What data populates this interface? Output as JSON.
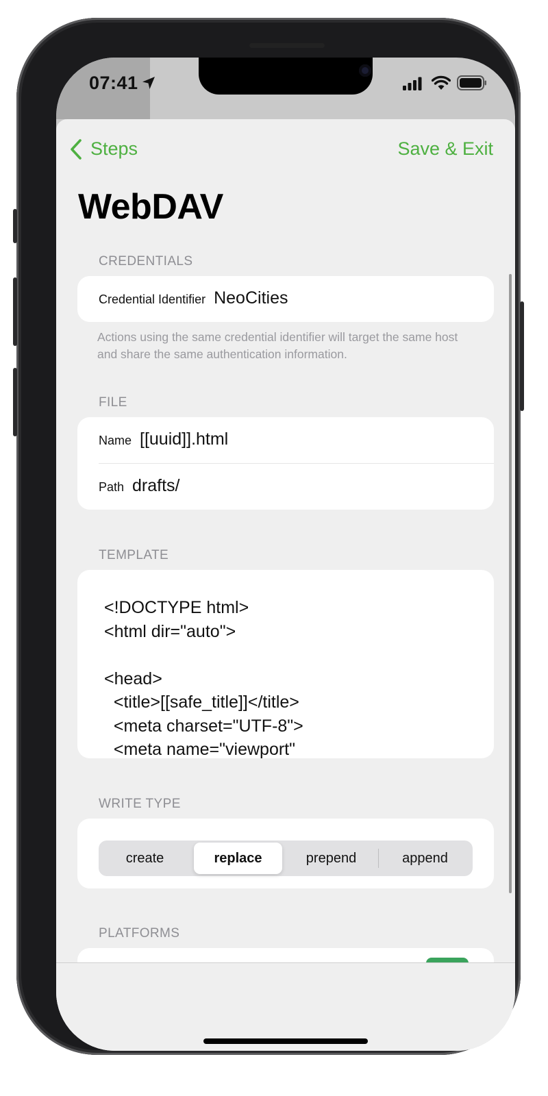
{
  "status_bar": {
    "time": "07:41"
  },
  "nav": {
    "back_label": "Steps",
    "save_label": "Save & Exit"
  },
  "page_title": "WebDAV",
  "credentials": {
    "header": "CREDENTIALS",
    "label": "Credential Identifier",
    "value": "NeoCities",
    "footnote": "Actions using the same credential identifier will target the same host and share the same authentication information."
  },
  "file": {
    "header": "FILE",
    "name_label": "Name",
    "name_value": "[[uuid]].html",
    "path_label": "Path",
    "path_value": "drafts/"
  },
  "template": {
    "header": "TEMPLATE",
    "text": "<!DOCTYPE html>\n<html dir=\"auto\">\n\n<head>\n  <title>[[safe_title]]</title>\n  <meta charset=\"UTF-8\">\n  <meta name=\"viewport\""
  },
  "write_type": {
    "header": "WRITE TYPE",
    "options": [
      "create",
      "replace",
      "prepend",
      "append"
    ],
    "selected": "replace"
  },
  "platforms": {
    "header": "PLATFORMS"
  },
  "colors": {
    "accent": "#4eb041",
    "background": "#efefef",
    "card": "#ffffff",
    "section_header": "#8e8e93"
  }
}
